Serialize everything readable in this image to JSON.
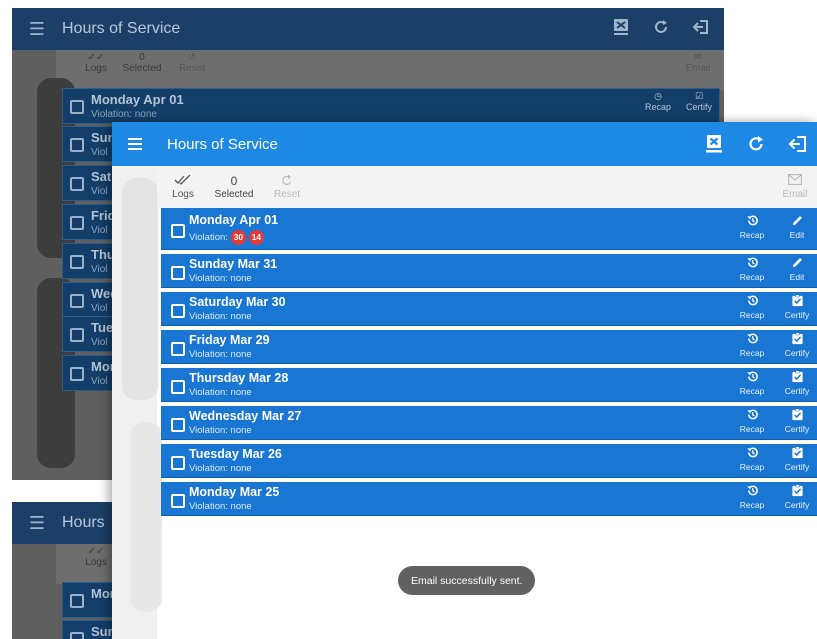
{
  "app": {
    "title": "Hours of Service"
  },
  "toolbar": {
    "logs_label": "Logs",
    "selected_count": "0",
    "selected_label": "Selected",
    "reset_label": "Reset",
    "email_label": "Email"
  },
  "background": {
    "app_title": "Hours of Service",
    "partial_title": "Hours",
    "toolbar": {
      "logs_label": "Logs",
      "selected_count": "0",
      "selected_label": "Selected",
      "reset_label": "Reset",
      "email_label": "Email"
    },
    "first_row": {
      "date": "Monday Apr 01",
      "violation": "Violation: none",
      "recap_label": "Recap",
      "certify_label": "Certify"
    },
    "rows_partial": [
      {
        "date": "Sun",
        "violation": "Viol"
      },
      {
        "date": "Sat",
        "violation": "Viol"
      },
      {
        "date": "Frid",
        "violation": "Viol"
      },
      {
        "date": "Thu",
        "violation": "Viol"
      },
      {
        "date": "Wed",
        "violation": "Viol"
      },
      {
        "date": "Tue",
        "violation": "Viol"
      },
      {
        "date": "Mon",
        "violation": "Viol"
      }
    ],
    "rows_partial_2": [
      {
        "date": "Mon"
      },
      {
        "date": "Sun"
      }
    ]
  },
  "logs": [
    {
      "date": "Monday Apr 01",
      "violation_label": "Violation:",
      "violation_badges": [
        "30",
        "14"
      ],
      "recap_label": "Recap",
      "action_label": "Edit",
      "action_icon": "pencil-icon"
    },
    {
      "date": "Sunday Mar 31",
      "violation_label": "Violation: none",
      "recap_label": "Recap",
      "action_label": "Edit",
      "action_icon": "pencil-icon"
    },
    {
      "date": "Saturday Mar 30",
      "violation_label": "Violation: none",
      "recap_label": "Recap",
      "action_label": "Certify",
      "action_icon": "clipboard-check-icon"
    },
    {
      "date": "Friday Mar 29",
      "violation_label": "Violation: none",
      "recap_label": "Recap",
      "action_label": "Certify",
      "action_icon": "clipboard-check-icon"
    },
    {
      "date": "Thursday Mar 28",
      "violation_label": "Violation: none",
      "recap_label": "Recap",
      "action_label": "Certify",
      "action_icon": "clipboard-check-icon"
    },
    {
      "date": "Wednesday Mar 27",
      "violation_label": "Violation: none",
      "recap_label": "Recap",
      "action_label": "Certify",
      "action_icon": "clipboard-check-icon"
    },
    {
      "date": "Tuesday Mar 26",
      "violation_label": "Violation: none",
      "recap_label": "Recap",
      "action_label": "Certify",
      "action_icon": "clipboard-check-icon"
    },
    {
      "date": "Monday Mar 25",
      "violation_label": "Violation: none",
      "recap_label": "Recap",
      "action_label": "Certify",
      "action_icon": "clipboard-check-icon"
    }
  ],
  "toast": {
    "message": "Email successfully sent."
  },
  "icons": {
    "menu": "hamburger-menu-icon",
    "export": "export-device-icon",
    "refresh": "refresh-icon",
    "logout": "logout-icon",
    "logs": "double-check-icon",
    "reset": "undo-icon",
    "email": "envelope-icon",
    "recap": "history-icon"
  },
  "colors": {
    "appbar": "#1e88e5",
    "row": "#1976d2",
    "violation_badge": "#e53935",
    "toast": "#616161",
    "dim_appbar": "#1b3f66",
    "dim_background": "#5f5f5f"
  }
}
